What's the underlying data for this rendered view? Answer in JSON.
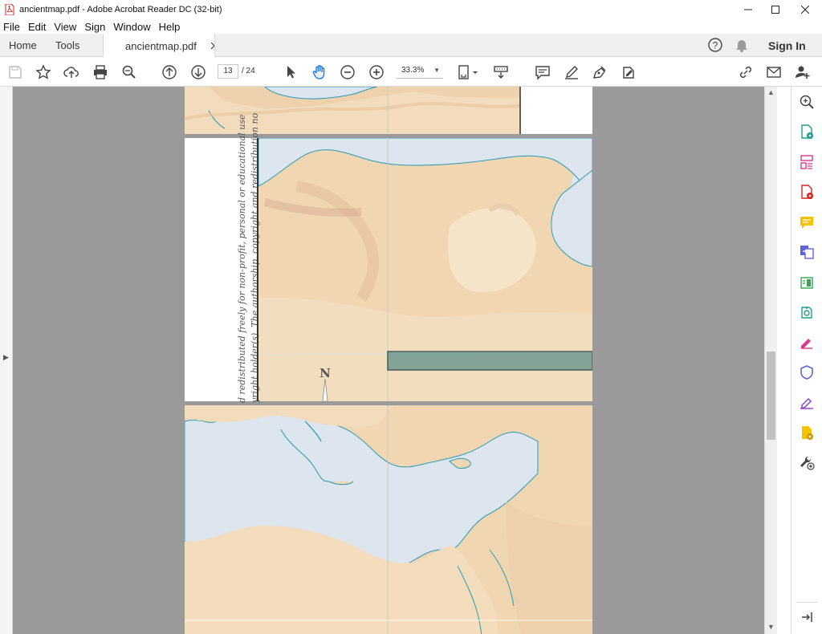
{
  "window": {
    "title": "ancientmap.pdf - Adobe Acrobat Reader DC (32-bit)",
    "controls": [
      "minimize",
      "maximize",
      "close"
    ]
  },
  "menu": {
    "items": [
      "File",
      "Edit",
      "View",
      "Sign",
      "Window",
      "Help"
    ]
  },
  "tabs": {
    "home": "Home",
    "tools": "Tools",
    "document": "ancientmap.pdf",
    "sign_in": "Sign In"
  },
  "toolbar": {
    "current_page": "13",
    "total_pages": "/ 24",
    "zoom": "33.3%"
  },
  "page_content": {
    "copyright_line1": "d redistributed freely for non-profit, personal or educational use",
    "copyright_line2": "yright holder(s). The authorship, copyright and redistribution no",
    "compass": "N"
  },
  "colors": {
    "land": "#f0d5b0",
    "sea": "#dde5ee",
    "coast": "#2a9bb8",
    "selection": "#6f9a8e",
    "accent_red": "#d9231f",
    "viewer_bg": "#9a9a9a"
  }
}
